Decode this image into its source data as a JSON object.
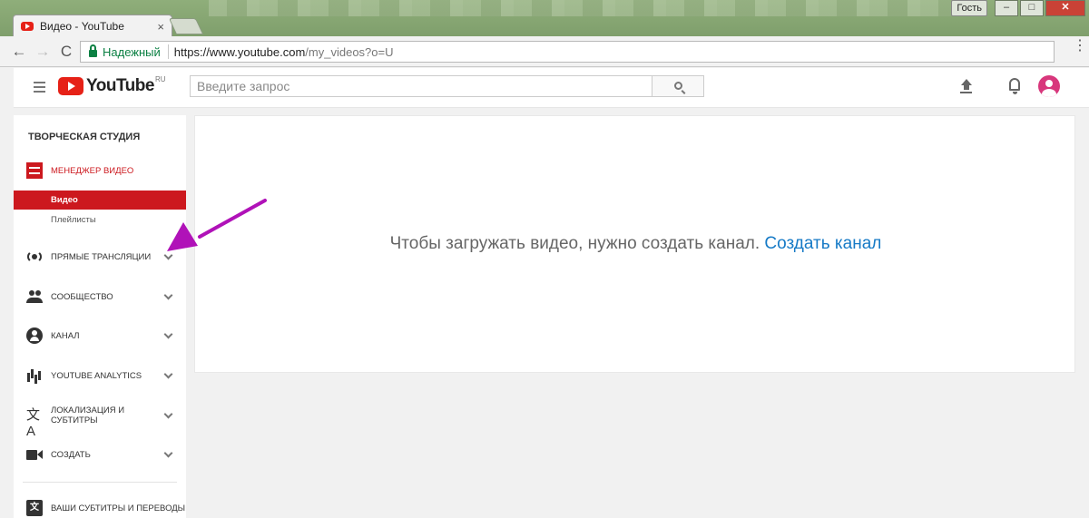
{
  "browser": {
    "tab_title": "Видео - YouTube",
    "tab_close": "×",
    "guest_label": "Гость",
    "win_min": "–",
    "win_max": "□",
    "win_close": "✕",
    "back": "←",
    "forward": "→",
    "reload": "C",
    "secure_label": "Надежный",
    "url_base": "https://www.youtube.com",
    "url_path": "/my_videos?o=U",
    "menu": "⋮"
  },
  "header": {
    "logo_text": "YouTube",
    "region": "RU",
    "search_placeholder": "Введите запрос"
  },
  "sidebar": {
    "title": "ТВОРЧЕСКАЯ СТУДИЯ",
    "video_manager": "МЕНЕДЖЕР ВИДЕО",
    "sub_active": "Видео",
    "sub_playlists": "Плейлисты",
    "items": [
      {
        "label": "ПРЯМЫЕ ТРАНСЛЯЦИИ"
      },
      {
        "label": "СООБЩЕСТВО"
      },
      {
        "label": "КАНАЛ"
      },
      {
        "label": "YOUTUBE ANALYTICS"
      },
      {
        "label": "ЛОКАЛИЗАЦИЯ И СУБТИТРЫ"
      },
      {
        "label": "СОЗДАТЬ"
      },
      {
        "label": "ВАШИ СУБТИТРЫ И ПЕРЕВОДЫ"
      }
    ],
    "translate_glyph": "文A",
    "subs_glyph": "文"
  },
  "main": {
    "message": "Чтобы загружать видео, нужно создать канал.",
    "create_link": "Создать канал"
  },
  "colors": {
    "accent_red": "#cc181e",
    "link_blue": "#167ac6",
    "annotation": "#b012b8"
  }
}
